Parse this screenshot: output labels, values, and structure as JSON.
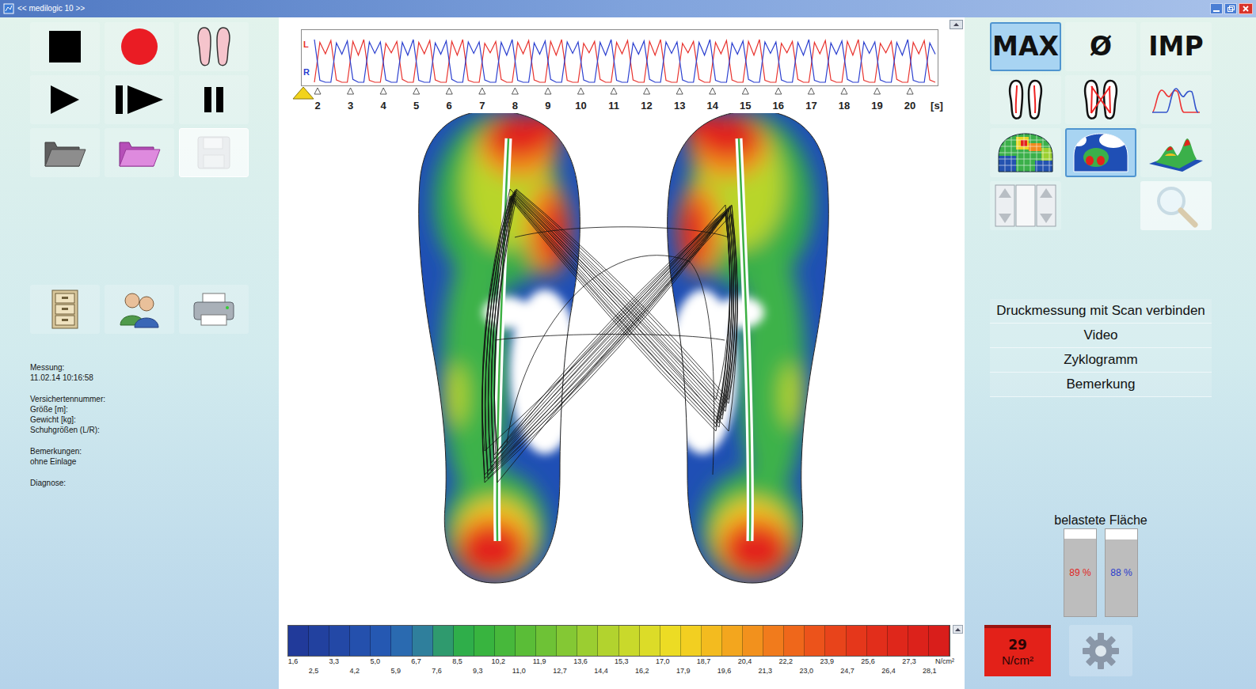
{
  "window": {
    "title": "<< medilogic 10 >>"
  },
  "toolbar": [
    {
      "kind": "stop",
      "disabled": false
    },
    {
      "kind": "record",
      "disabled": false
    },
    {
      "kind": "feet",
      "disabled": false
    },
    {
      "kind": "play",
      "disabled": false
    },
    {
      "kind": "step",
      "disabled": false
    },
    {
      "kind": "pause",
      "disabled": false
    },
    {
      "kind": "open",
      "disabled": false
    },
    {
      "kind": "open-pink",
      "disabled": false
    },
    {
      "kind": "save",
      "disabled": true
    }
  ],
  "tools": [
    {
      "kind": "archive",
      "disabled": false
    },
    {
      "kind": "patients",
      "disabled": false
    },
    {
      "kind": "print",
      "disabled": false
    }
  ],
  "info": [
    [
      "Messung:",
      "11.02.14 10:16:58"
    ],
    [
      "Versichertennummer:",
      "Größe [m]:",
      "Gewicht [kg]:",
      "Schuhgrößen (L/R):"
    ],
    [
      "Bemerkungen:",
      "ohne Einlage"
    ],
    [
      "Diagnose:"
    ]
  ],
  "chart": {
    "series": [
      {
        "label": "L",
        "color": "#e8322d",
        "values": [
          0,
          84,
          60,
          88,
          5,
          0,
          0,
          86,
          57,
          90,
          4,
          0,
          0,
          82,
          62,
          86,
          6,
          0,
          0,
          84,
          60,
          88,
          5,
          0,
          0,
          86,
          57,
          90,
          4,
          0,
          0,
          82,
          62,
          86,
          6,
          0,
          0,
          84,
          60,
          88,
          5,
          0,
          0,
          86,
          57,
          90,
          4,
          0,
          0,
          82,
          62,
          86,
          6,
          0,
          0,
          84,
          60,
          88,
          5,
          0,
          0,
          86,
          57,
          90,
          4,
          0,
          0,
          82,
          62,
          86,
          6,
          0,
          0,
          84,
          60,
          88,
          5,
          0,
          0,
          86,
          57,
          90,
          4,
          0,
          0,
          82,
          62,
          86,
          6,
          0,
          0,
          84,
          60,
          88,
          5,
          0,
          0,
          86,
          57,
          90,
          4,
          0,
          0,
          82,
          62,
          86,
          6,
          0,
          0,
          84,
          60,
          88,
          5,
          0
        ]
      },
      {
        "label": "R",
        "color": "#2b3fcf",
        "values": [
          90,
          4,
          0,
          0,
          83,
          59,
          87,
          6,
          0,
          0,
          85,
          61,
          85,
          5,
          0,
          0,
          84,
          57,
          90,
          4,
          0,
          0,
          83,
          59,
          87,
          6,
          0,
          0,
          85,
          61,
          85,
          5,
          0,
          0,
          84,
          57,
          90,
          4,
          0,
          0,
          83,
          59,
          87,
          6,
          0,
          0,
          85,
          61,
          85,
          5,
          0,
          0,
          84,
          57,
          90,
          4,
          0,
          0,
          83,
          59,
          87,
          6,
          0,
          0,
          85,
          61,
          85,
          5,
          0,
          0,
          84,
          57,
          90,
          4,
          0,
          0,
          83,
          59,
          87,
          6,
          0,
          0,
          85,
          61,
          85,
          5,
          0,
          0,
          84,
          57,
          90,
          4,
          0,
          0,
          83,
          59,
          87,
          6,
          0,
          0,
          85,
          61,
          85,
          5,
          0,
          0,
          84,
          57,
          90,
          4,
          0,
          0,
          83,
          59
        ]
      }
    ],
    "ticks": [
      "2",
      "3",
      "4",
      "5",
      "6",
      "7",
      "8",
      "9",
      "10",
      "11",
      "12",
      "13",
      "14",
      "15",
      "16",
      "17",
      "18",
      "19",
      "20"
    ],
    "unit": "[s]"
  },
  "view_modes": [
    {
      "label": "MAX",
      "selected": true
    },
    {
      "label": "Ø",
      "selected": false
    },
    {
      "label": "IMP",
      "selected": false
    }
  ],
  "display_buttons": [
    {
      "kind": "foot-lines",
      "selected": false,
      "disabled": false
    },
    {
      "kind": "foot-cross",
      "selected": false,
      "disabled": false
    },
    {
      "kind": "waves",
      "selected": false,
      "disabled": false
    },
    {
      "kind": "grid-map",
      "selected": false,
      "disabled": false
    },
    {
      "kind": "heat-map",
      "selected": true,
      "disabled": false
    },
    {
      "kind": "3d-map",
      "selected": false,
      "disabled": false
    },
    {
      "kind": "arrows",
      "selected": false,
      "disabled": false
    },
    {
      "kind": "magnifier",
      "selected": false,
      "disabled": true
    }
  ],
  "menu": [
    "Druckmessung mit Scan verbinden",
    "Video",
    "Zyklogramm",
    "Bemerkung"
  ],
  "loaded_area": {
    "title": "belastete Fläche",
    "bars": [
      {
        "reading": "89 %",
        "level": 0.89,
        "color": "#e0261f"
      },
      {
        "reading": "88 %",
        "level": 0.88,
        "color": "#2a3ccc"
      }
    ]
  },
  "scale": {
    "colors": [
      "#213a9a",
      "#22419f",
      "#2348a6",
      "#2450ad",
      "#2558b2",
      "#2a6ab0",
      "#2f7f9c",
      "#2f9a6e",
      "#2fae4a",
      "#38b43f",
      "#47b83b",
      "#5abd37",
      "#6ec236",
      "#84c834",
      "#9bce31",
      "#b2d32e",
      "#c9d92b",
      "#dcdc28",
      "#ecdc24",
      "#f2cf21",
      "#f3bb1f",
      "#f3a61e",
      "#f2911d",
      "#f17b1c",
      "#ef671b",
      "#ec531b",
      "#e8441b",
      "#e5371b",
      "#e22e1b",
      "#df271b",
      "#dc221b",
      "#d91e1b"
    ],
    "upper": [
      "1,6",
      "3,3",
      "5,0",
      "6,7",
      "8,5",
      "10,2",
      "11,9",
      "13,6",
      "15,3",
      "17,0",
      "18,7",
      "20,4",
      "22,2",
      "23,9",
      "25,6",
      "27,3"
    ],
    "lower": [
      "2,5",
      "4,2",
      "5,9",
      "7,6",
      "9,3",
      "11,0",
      "12,7",
      "14,4",
      "16,2",
      "17,9",
      "19,6",
      "21,3",
      "23,0",
      "24,7",
      "26,4",
      "28,1"
    ],
    "unit": "N/cm²"
  },
  "max_value": {
    "value": "29",
    "unit": "N/cm²"
  }
}
